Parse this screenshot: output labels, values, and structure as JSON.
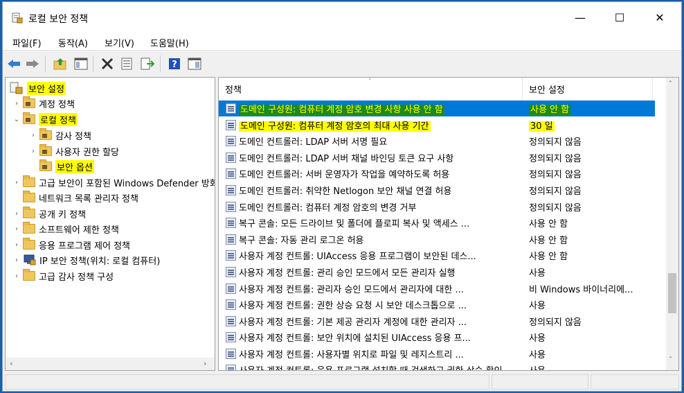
{
  "window": {
    "title": "로컬 보안 정책",
    "minimize_glyph": "—",
    "maximize_glyph": "☐",
    "close_glyph": "✕"
  },
  "menu": {
    "items": [
      "파일(F)",
      "동작(A)",
      "보기(V)",
      "도움말(H)"
    ]
  },
  "toolbar": {
    "icons": [
      "back-icon",
      "forward-icon",
      "up-folder-icon",
      "show-hide-tree-icon",
      "delete-icon",
      "properties-icon",
      "export-list-icon",
      "help-icon",
      "view-icon"
    ]
  },
  "tree": {
    "root": "보안 설정",
    "items": [
      {
        "label": "계정 정책",
        "twisty": "›"
      },
      {
        "label": "로컬 정책",
        "twisty": "⌄"
      },
      {
        "label": "감사 정책",
        "twisty": "›"
      },
      {
        "label": "사용자 권한 할당",
        "twisty": "›"
      },
      {
        "label": "보안 옵션",
        "twisty": ""
      },
      {
        "label": "고급 보안이 포함된 Windows Defender 방화벽",
        "twisty": "›"
      },
      {
        "label": "네트워크 목록 관리자 정책",
        "twisty": ""
      },
      {
        "label": "공개 키 정책",
        "twisty": "›"
      },
      {
        "label": "소프트웨어 제한 정책",
        "twisty": "›"
      },
      {
        "label": "응용 프로그램 제어 정책",
        "twisty": "›"
      },
      {
        "label": "IP 보안 정책(위치: 로컬 컴퓨터)",
        "twisty": "›"
      },
      {
        "label": "고급 감사 정책 구성",
        "twisty": "›"
      }
    ],
    "scroll_left": "‹",
    "scroll_right": "›"
  },
  "list": {
    "col_policy": "정책",
    "col_setting": "보안 설정",
    "sort_caret": "˄",
    "rows": [
      {
        "name": "도메인 구성원: 컴퓨터 계정 암호 변경 사항 사용 안 함",
        "value": "사용 안 함"
      },
      {
        "name": "도메인 구성원: 컴퓨터 계정 암호의 최대 사용 기간",
        "value": "30 일"
      },
      {
        "name": "도메인 컨트롤러: LDAP 서버 서명 필요",
        "value": "정의되지 않음"
      },
      {
        "name": "도메인 컨트롤러: LDAP 서버 채널 바인딩 토큰 요구 사항",
        "value": "정의되지 않음"
      },
      {
        "name": "도메인 컨트롤러: 서버 운영자가 작업을 예약하도록 허용",
        "value": "정의되지 않음"
      },
      {
        "name": "도메인 컨트롤러: 취약한 Netlogon 보안 채널 연결 허용",
        "value": "정의되지 않음"
      },
      {
        "name": "도메인 컨트롤러: 컴퓨터 계정 암호의 변경 거부",
        "value": "정의되지 않음"
      },
      {
        "name": "복구 콘솔: 모든 드라이브 및 폴더에 플로피 복사 및 액세스 ...",
        "value": "사용 안 함"
      },
      {
        "name": "복구 콘솔: 자동 관리 로그온 허용",
        "value": "사용 안 함"
      },
      {
        "name": "사용자 계정 컨트롤: UIAccess 응용 프로그램이 보안된 데스...",
        "value": "사용 안 함"
      },
      {
        "name": "사용자 계정 컨트롤: 관리 승인 모드에서 모든 관리자 실행",
        "value": "사용"
      },
      {
        "name": "사용자 계정 컨트롤: 관리자 승인 모드에서 관리자에 대한 ...",
        "value": "비 Windows 바이너리에..."
      },
      {
        "name": "사용자 계정 컨트롤: 권한 상승 요청 시 보안 데스크톱으로 ...",
        "value": "사용"
      },
      {
        "name": "사용자 계정 컨트롤: 기본 제공 관리자 계정에 대한 관리자 ...",
        "value": "정의되지 않음"
      },
      {
        "name": "사용자 계정 컨트롤: 보안 위치에 설치된 UIAccess 응용 프...",
        "value": "사용"
      },
      {
        "name": "사용자 계정 컨트롤: 사용자별 위치로 파일 및 레지스트리 ...",
        "value": "사용"
      },
      {
        "name": "사용자 계정 컨트롤: 응용 프로그램 설치할 때 검색하고 권한 상승 확인",
        "value": "사용"
      }
    ],
    "scroll_up": "˄",
    "scroll_down": "˅"
  },
  "colors": {
    "selection": "#0078d7",
    "highlight_yellow": "#ffff00",
    "highlight_green": "#1d8a1d"
  }
}
